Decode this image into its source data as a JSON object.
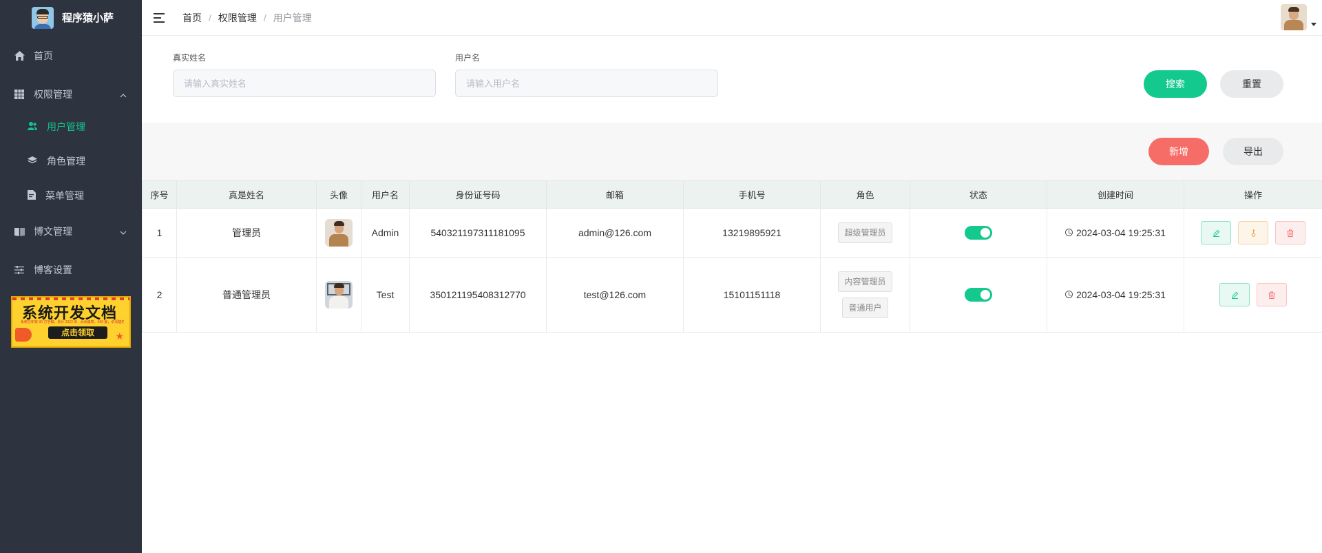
{
  "sidebar": {
    "brand": "程序猿小萨",
    "items": [
      {
        "label": "首页",
        "icon": "home-icon"
      },
      {
        "label": "权限管理",
        "icon": "grid-icon",
        "expanded": true,
        "children": [
          {
            "label": "用户管理",
            "icon": "users-icon",
            "active": true
          },
          {
            "label": "角色管理",
            "icon": "layers-icon"
          },
          {
            "label": "菜单管理",
            "icon": "document-icon"
          }
        ]
      },
      {
        "label": "博文管理",
        "icon": "book-icon",
        "expanded": false
      },
      {
        "label": "博客设置",
        "icon": "sliders-icon"
      }
    ],
    "promo": {
      "title": "系统开发文档",
      "subtitle": "系统已积累 30 万字稿，累计 2022 年 · 百余篇章，400 篇，讲清楚的事都在里",
      "button": "点击领取"
    }
  },
  "header": {
    "breadcrumb": [
      "首页",
      "权限管理",
      "用户管理"
    ]
  },
  "search": {
    "realname_label": "真实姓名",
    "realname_placeholder": "请输入真实姓名",
    "username_label": "用户名",
    "username_placeholder": "请输入用户名",
    "search_button": "搜索",
    "reset_button": "重置"
  },
  "toolbar": {
    "add_button": "新增",
    "export_button": "导出"
  },
  "table": {
    "columns": [
      "序号",
      "真是姓名",
      "头像",
      "用户名",
      "身份证号码",
      "邮箱",
      "手机号",
      "角色",
      "状态",
      "创建时间",
      "操作"
    ],
    "rows": [
      {
        "index": "1",
        "realname": "管理员",
        "username": "Admin",
        "id_card": "540321197311181095",
        "email": "admin@126.com",
        "phone": "13219895921",
        "roles": [
          "超级管理员"
        ],
        "status": true,
        "created": "2024-03-04 19:25:31"
      },
      {
        "index": "2",
        "realname": "普通管理员",
        "username": "Test",
        "id_card": "350121195408312770",
        "email": "test@126.com",
        "phone": "15101151118",
        "roles": [
          "内容管理员",
          "普通用户"
        ],
        "status": true,
        "created": "2024-03-04 19:25:31"
      }
    ]
  },
  "colors": {
    "accent": "#14c98d",
    "danger": "#f66d68",
    "sidebar_bg": "#2d3440",
    "warning": "#e6a23c"
  }
}
